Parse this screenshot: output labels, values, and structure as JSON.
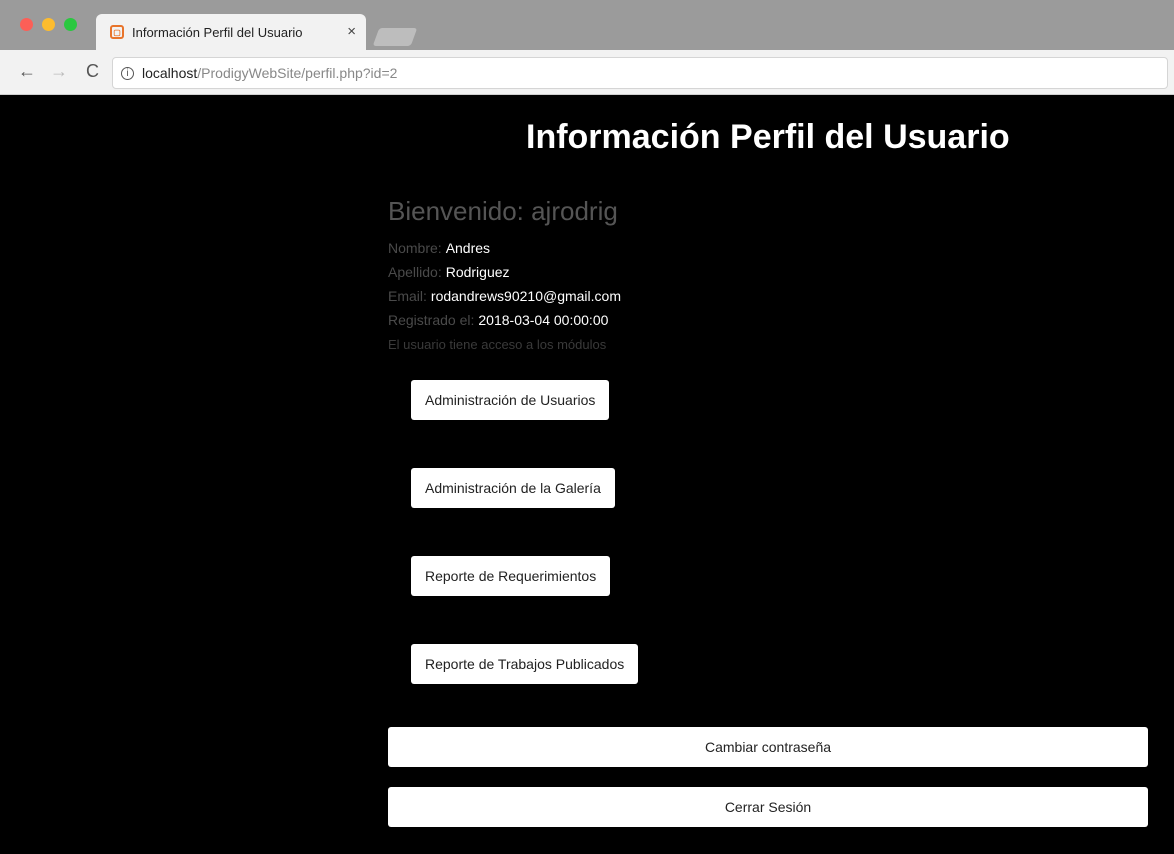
{
  "browser": {
    "tab_title": "Información Perfil del Usuario",
    "tab_close": "×",
    "url_host": "localhost",
    "url_path": "/ProdigyWebSite/perfil.php?id=2",
    "back_glyph": "←",
    "forward_glyph": "→",
    "reload_glyph": "C"
  },
  "page": {
    "title": "Información Perfil del Usuario",
    "welcome": "Bienvenido: ajrodrig",
    "fields": [
      {
        "label": "Nombre:",
        "value": "Andres"
      },
      {
        "label": "Apellido:",
        "value": "Rodriguez"
      },
      {
        "label": "Email:",
        "value": "rodandrews90210@gmail.com"
      },
      {
        "label": "Registrado el:",
        "value": "2018-03-04 00:00:00"
      }
    ],
    "access_note": "El usuario tiene acceso a los módulos",
    "modules": [
      "Administración de Usuarios",
      "Administración de la Galería",
      "Reporte de Requerimientos",
      "Reporte de Trabajos Publicados"
    ],
    "change_password": "Cambiar contraseña",
    "logout": "Cerrar Sesión"
  }
}
